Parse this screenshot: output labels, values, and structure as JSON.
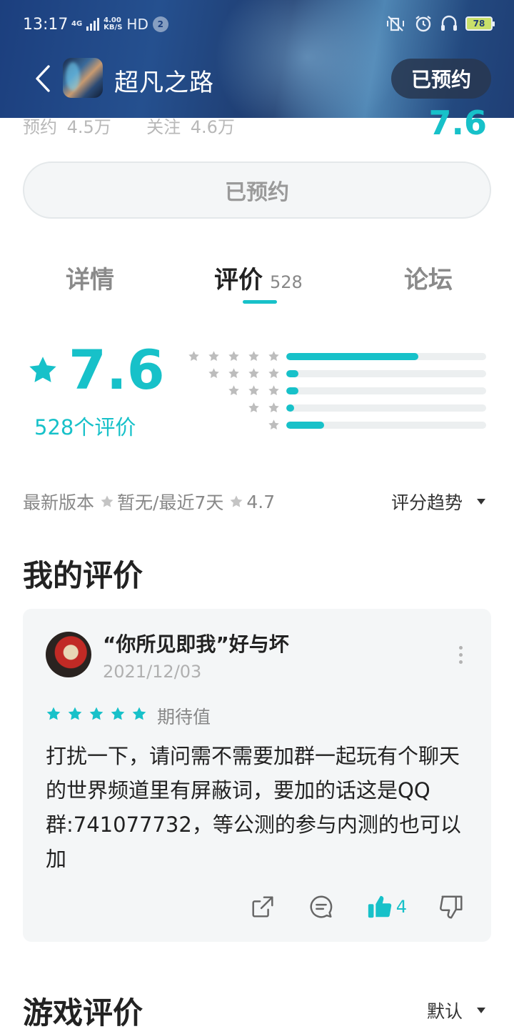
{
  "status_bar": {
    "time": "13:17",
    "network_gen": "4G",
    "speed_value": "4.00",
    "speed_unit": "KB/S",
    "hd": "HD",
    "notification_count": "2",
    "battery": "78"
  },
  "nav": {
    "title": "超凡之路",
    "reserve_status": "已预约"
  },
  "stats": {
    "reserve_label": "预约",
    "reserve_value": "4.5万",
    "follow_label": "关注",
    "follow_value": "4.6万",
    "score": "7.6"
  },
  "reserve_button": "已预约",
  "tabs": {
    "details": "详情",
    "reviews": "评价",
    "reviews_count": "528",
    "forum": "论坛"
  },
  "rating": {
    "value": "7.6",
    "count_label": "528个评价",
    "distribution": [
      {
        "stars": 5,
        "fraction": 0.66
      },
      {
        "stars": 4,
        "fraction": 0.06
      },
      {
        "stars": 3,
        "fraction": 0.06
      },
      {
        "stars": 2,
        "fraction": 0.04
      },
      {
        "stars": 1,
        "fraction": 0.19
      }
    ],
    "latest_version_label": "最新版本",
    "latest_version_value": "暂无",
    "recent_label": "/最近7天",
    "recent_value": "4.7",
    "trend_label": "评分趋势"
  },
  "my_review": {
    "section_title": "我的评价",
    "user_name": "“你所见即我”好与坏",
    "date": "2021/12/03",
    "stars": 5,
    "tag": "期待值",
    "text": "打扰一下，请问需不需要加群一起玩有个聊天的世界频道里有屏蔽词，要加的话这是QQ群:741077732，等公测的参与内测的也可以加",
    "like_count": "4"
  },
  "game_reviews": {
    "section_title": "游戏评价",
    "sort_label": "默认"
  },
  "colors": {
    "accent": "#17c1c9",
    "header_blue": "#1f3e75",
    "card_bg": "#f4f6f7"
  },
  "icons": {
    "back": "chevron-left-icon",
    "share": "share-icon",
    "comment": "comment-icon",
    "like": "thumbs-up-icon",
    "dislike": "thumbs-down-icon",
    "more": "more-vertical-icon"
  }
}
